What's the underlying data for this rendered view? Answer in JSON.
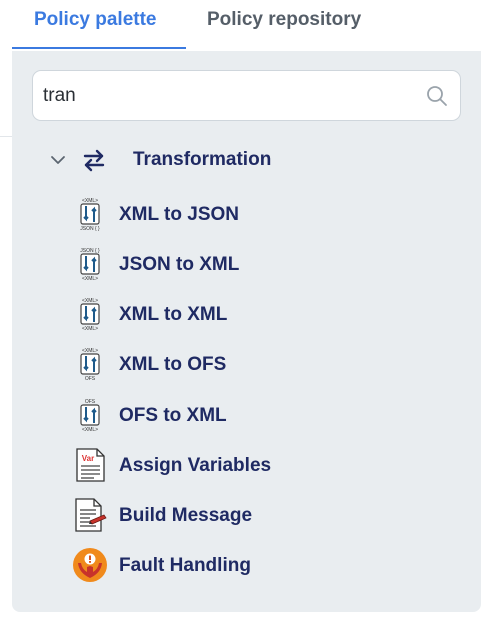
{
  "tabs": [
    {
      "label": "Policy palette",
      "active": true
    },
    {
      "label": "Policy repository",
      "active": false
    }
  ],
  "search": {
    "value": "tran",
    "icon": "search-icon"
  },
  "group": {
    "label": "Transformation",
    "expanded": true,
    "icon": "transfer-arrows-icon"
  },
  "items": [
    {
      "label": "XML to JSON",
      "icon": "xml-to-json-icon",
      "icon_top": "<XML>",
      "icon_bottom": "JSON { }"
    },
    {
      "label": "JSON to XML",
      "icon": "json-to-xml-icon",
      "icon_top": "JSON { }",
      "icon_bottom": "<XML>"
    },
    {
      "label": "XML to XML",
      "icon": "xml-to-xml-icon",
      "icon_top": "<XML>",
      "icon_bottom": "<XML>"
    },
    {
      "label": "XML to OFS",
      "icon": "xml-to-ofs-icon",
      "icon_top": "<XML>",
      "icon_bottom": "OFS"
    },
    {
      "label": "OFS to XML",
      "icon": "ofs-to-xml-icon",
      "icon_top": "OFS",
      "icon_bottom": "<XML>"
    },
    {
      "label": "Assign Variables",
      "icon": "assign-variables-icon",
      "icon_text": "Var"
    },
    {
      "label": "Build Message",
      "icon": "build-message-icon"
    },
    {
      "label": "Fault Handling",
      "icon": "fault-handling-icon"
    }
  ],
  "colors": {
    "accent": "#3b7ae0",
    "label": "#1f2a63",
    "panel": "#e9edf0",
    "fault": "#f08a1c"
  }
}
